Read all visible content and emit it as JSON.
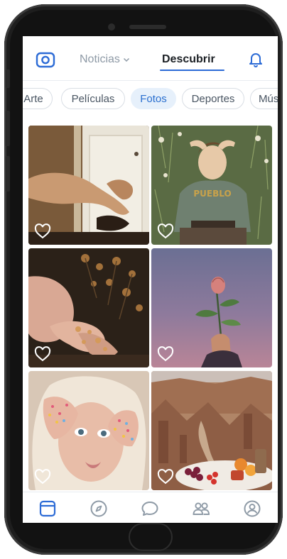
{
  "header": {
    "camera_icon": "camera-icon",
    "news_tab_label": "Noticias",
    "discover_tab_label": "Descubrir",
    "bell_icon": "bell-icon"
  },
  "categories": [
    {
      "label": "Arte",
      "active": false
    },
    {
      "label": "Películas",
      "active": false
    },
    {
      "label": "Fotos",
      "active": true
    },
    {
      "label": "Deportes",
      "active": false
    },
    {
      "label": "Mús",
      "active": false
    }
  ],
  "photos": [
    {
      "subject": "woman-reclining-in-doorway",
      "icon": "heart-icon"
    },
    {
      "subject": "woman-lying-on-grass",
      "icon": "heart-icon"
    },
    {
      "subject": "hands-with-dried-flowers",
      "icon": "heart-icon"
    },
    {
      "subject": "hand-holding-rose",
      "icon": "heart-icon"
    },
    {
      "subject": "face-with-glitter-hands",
      "icon": "heart-icon"
    },
    {
      "subject": "canyon-picnic",
      "icon": "heart-icon"
    }
  ],
  "bottom_nav": [
    {
      "icon": "feed-icon",
      "active": true
    },
    {
      "icon": "compass-icon",
      "active": false
    },
    {
      "icon": "chat-icon",
      "active": false
    },
    {
      "icon": "friends-icon",
      "active": false
    },
    {
      "icon": "profile-icon",
      "active": false
    }
  ],
  "colors": {
    "accent": "#2c6bd6",
    "icon": "#2c6bd6",
    "inactive_icon": "#8e9aa6"
  }
}
